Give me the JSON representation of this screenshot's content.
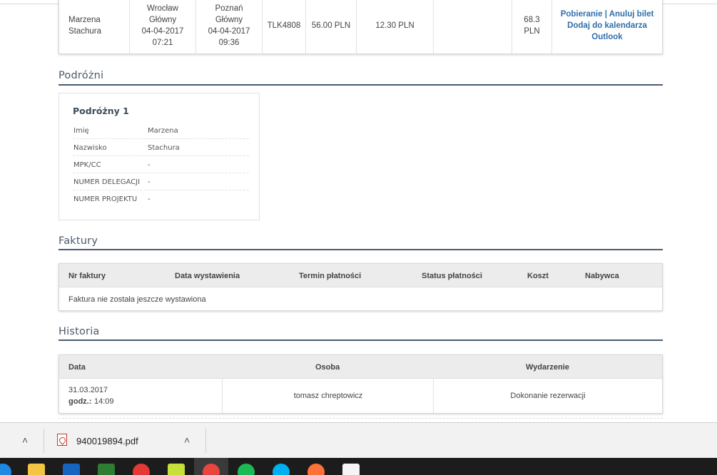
{
  "ticket_row": {
    "passenger": "Marzena Stachura",
    "from_station": "Wrocław Główny",
    "from_date": "04-04-2017",
    "from_time": "07:21",
    "to_station": "Poznań Główny",
    "to_date": "04-04-2017",
    "to_time": "09:36",
    "train": "TLK4808",
    "price": "56.00 PLN",
    "fee": "12.30 PLN",
    "extra": "",
    "total": "68.3 PLN",
    "link_download": "Pobieranie",
    "link_sep": "|",
    "link_cancel": "Anuluj bilet",
    "link_calendar": "Dodaj do kalendarza Outlook"
  },
  "travelers": {
    "title": "Podróżni",
    "card_title": "Podróżny 1",
    "rows": [
      {
        "label": "Imię",
        "value": "Marzena"
      },
      {
        "label": "Nazwisko",
        "value": "Stachura"
      },
      {
        "label": "MPK/CC",
        "value": "-"
      },
      {
        "label": "NUMER DELEGACJI",
        "value": "-"
      },
      {
        "label": "NUMER PROJEKTU",
        "value": "-"
      }
    ]
  },
  "invoices": {
    "title": "Faktury",
    "headers": [
      "Nr faktury",
      "Data wystawienia",
      "Termin płatności",
      "Status płatności",
      "Koszt",
      "Nabywca"
    ],
    "empty_text": "Faktura nie została jeszcze wystawiona"
  },
  "history": {
    "title": "Historia",
    "headers": [
      "Data",
      "Osoba",
      "Wydarzenie"
    ],
    "rows": [
      {
        "date": "31.03.2017",
        "time_label": "godz.:",
        "time": "14:09",
        "person": "tomasz chreptowicz",
        "event": "Dokonanie rezerwacji"
      }
    ]
  },
  "download_bar": {
    "file_name": "940019894.pdf"
  },
  "taskbar": {
    "icons": [
      "edge-icon",
      "file-explorer-icon",
      "outlook-icon",
      "excel-icon",
      "sun-app-icon",
      "notes-icon",
      "chrome-icon",
      "spotify-icon",
      "skype-icon",
      "firefox-icon",
      "photos-icon"
    ]
  }
}
